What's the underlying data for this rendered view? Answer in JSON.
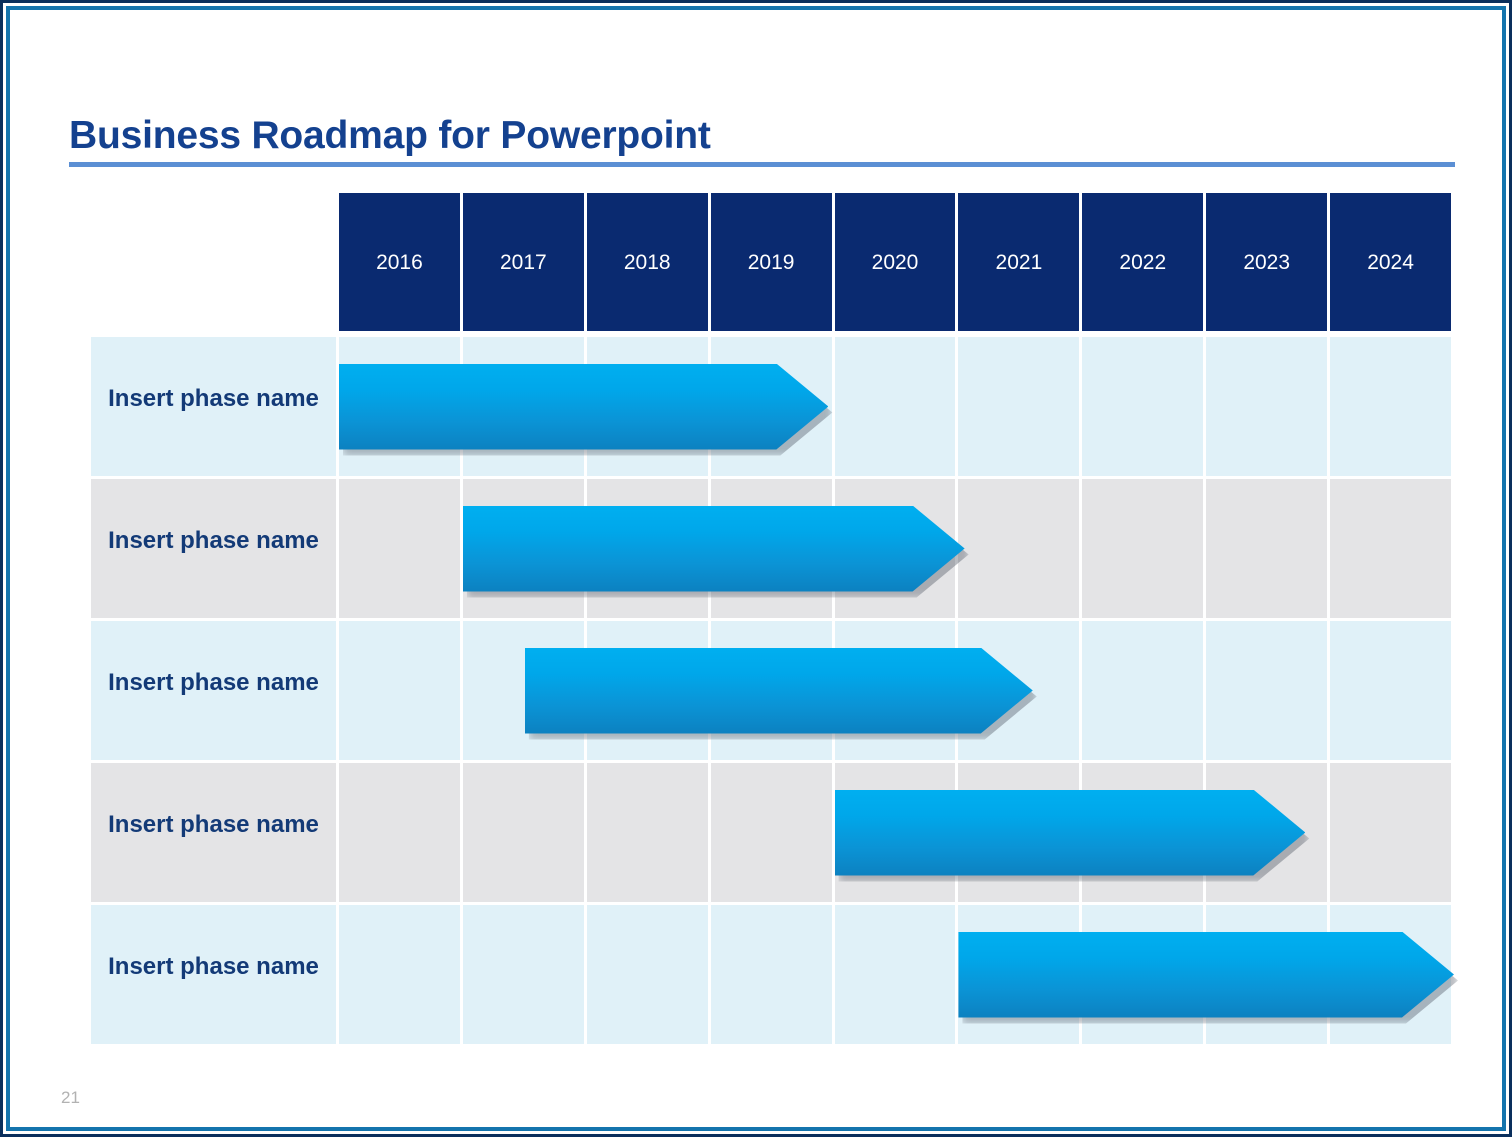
{
  "slide": {
    "title": "Business Roadmap for Powerpoint",
    "page_number": "21",
    "colors": {
      "border_outer": "#0a2f5c",
      "border_inner": "#1474ad",
      "title_text": "#14418f",
      "title_rule": "#5b8fd4",
      "header_cell": "#0a2a70",
      "header_text": "#ffffff",
      "row_tint_blue": "#e0f1f8",
      "row_tint_gray": "#e4e4e6",
      "phase_text": "#133a77",
      "arrow_top": "#00aff0",
      "arrow_bottom": "#0c81c0",
      "page_number": "#b2b2b2"
    }
  },
  "chart_data": {
    "type": "bar",
    "title": "Business Roadmap for Powerpoint",
    "subtitle": "",
    "xlabel": "",
    "ylabel": "",
    "orientation": "horizontal",
    "chart_style": "gantt-roadmap",
    "grid": true,
    "legend": "none",
    "categories": [
      "Insert phase name",
      "Insert phase name",
      "Insert phase name",
      "Insert phase name",
      "Insert phase name"
    ],
    "x_tick_labels": [
      "2016",
      "2017",
      "2018",
      "2019",
      "2020",
      "2021",
      "2022",
      "2023",
      "2024"
    ],
    "xlim": [
      2016,
      2025
    ],
    "bars": [
      {
        "label": "Insert phase name",
        "start": 2016.0,
        "end": 2019.95,
        "start_col": 0,
        "span_cols": 3.95,
        "row": 1
      },
      {
        "label": "Insert phase name",
        "start": 2017.0,
        "end": 2021.05,
        "start_col": 1,
        "span_cols": 4.05,
        "row": 2
      },
      {
        "label": "Insert phase name",
        "start": 2017.5,
        "end": 2021.6,
        "start_col": 1.5,
        "span_cols": 4.1,
        "row": 3
      },
      {
        "label": "Insert phase name",
        "start": 2020.0,
        "end": 2023.8,
        "start_col": 4,
        "span_cols": 3.8,
        "row": 4
      },
      {
        "label": "Insert phase name",
        "start": 2021.0,
        "end": 2025.0,
        "start_col": 5,
        "span_cols": 4.0,
        "row": 5
      }
    ]
  },
  "timeline": {
    "years": [
      "2016",
      "2017",
      "2018",
      "2019",
      "2020",
      "2021",
      "2022",
      "2023",
      "2024"
    ],
    "rows": [
      {
        "phase": "Insert phase name",
        "tint": "blue"
      },
      {
        "phase": "Insert phase name",
        "tint": "gray"
      },
      {
        "phase": "Insert phase name",
        "tint": "blue"
      },
      {
        "phase": "Insert phase name",
        "tint": "gray"
      },
      {
        "phase": "Insert phase name",
        "tint": "blue"
      }
    ]
  }
}
